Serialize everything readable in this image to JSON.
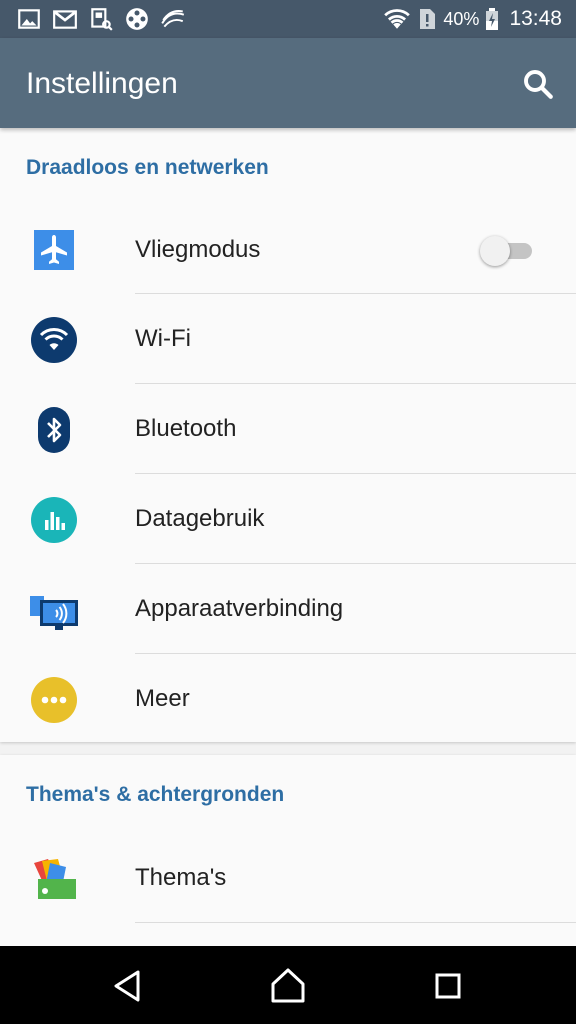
{
  "status_bar": {
    "notification_icons": [
      "gallery-icon",
      "gmail-icon",
      "screenshot-icon",
      "film-reel-icon",
      "swiftkey-icon"
    ],
    "battery_percent_text": "40%",
    "clock": "13:48"
  },
  "app_bar": {
    "title": "Instellingen",
    "search_icon": "search-icon"
  },
  "sections": [
    {
      "header": "Draadloos en netwerken",
      "items": [
        {
          "label": "Vliegmodus",
          "icon": "airplane-icon",
          "toggle": false
        },
        {
          "label": "Wi-Fi",
          "icon": "wifi-icon"
        },
        {
          "label": "Bluetooth",
          "icon": "bluetooth-icon"
        },
        {
          "label": "Datagebruik",
          "icon": "data-usage-icon"
        },
        {
          "label": "Apparaatverbinding",
          "icon": "device-connection-icon"
        },
        {
          "label": "Meer",
          "icon": "more-icon"
        }
      ]
    },
    {
      "header": "Thema's & achtergronden",
      "items": [
        {
          "label": "Thema's",
          "icon": "themes-icon"
        }
      ]
    }
  ],
  "nav_bar": {
    "buttons": [
      "back-icon",
      "home-icon",
      "recents-icon"
    ]
  },
  "colors": {
    "status_bar": "#46586a",
    "app_bar": "#566c7e",
    "section_header": "#2e6ea4",
    "airplane_icon": "#3d8ee8",
    "wifi_icon": "#0d3a6e",
    "bluetooth_icon": "#0d3a6e",
    "data_usage_icon": "#1ab5b8",
    "more_icon": "#e8c02a"
  }
}
